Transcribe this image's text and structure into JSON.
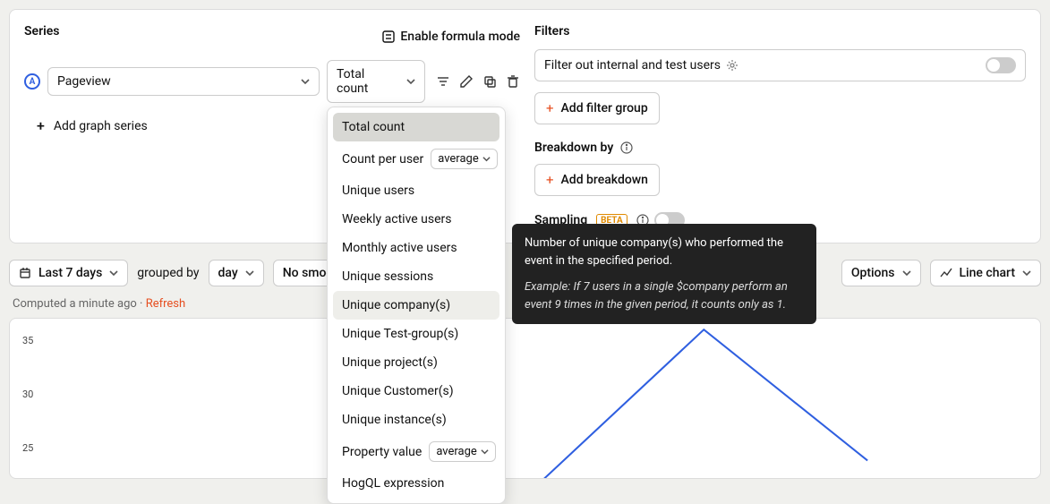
{
  "series": {
    "label": "Series",
    "formula_mode": "Enable formula mode",
    "badge": "A",
    "event": "Pageview",
    "agg": "Total count",
    "add_series": "Add graph series"
  },
  "dropdown": {
    "items": [
      {
        "label": "Total count",
        "sub": null,
        "state": "selected"
      },
      {
        "label": "Count per user",
        "sub": "average",
        "state": ""
      },
      {
        "label": "Unique users",
        "sub": null,
        "state": ""
      },
      {
        "label": "Weekly active users",
        "sub": null,
        "state": ""
      },
      {
        "label": "Monthly active users",
        "sub": null,
        "state": ""
      },
      {
        "label": "Unique sessions",
        "sub": null,
        "state": ""
      },
      {
        "label": "Unique company(s)",
        "sub": null,
        "state": "hover"
      },
      {
        "label": "Unique Test-group(s)",
        "sub": null,
        "state": ""
      },
      {
        "label": "Unique project(s)",
        "sub": null,
        "state": ""
      },
      {
        "label": "Unique Customer(s)",
        "sub": null,
        "state": ""
      },
      {
        "label": "Unique instance(s)",
        "sub": null,
        "state": ""
      },
      {
        "label": "Property value",
        "sub": "average",
        "state": ""
      },
      {
        "label": "HogQL expression",
        "sub": null,
        "state": ""
      }
    ]
  },
  "tooltip": {
    "body": "Number of unique company(s) who performed the event in the specified period.",
    "example": "Example: If 7 users in a single $company perform an event 9 times in the given period, it counts only as 1."
  },
  "filters": {
    "label": "Filters",
    "default_filter": "Filter out internal and test users",
    "add_filter_group": "Add filter group",
    "breakdown_label": "Breakdown by",
    "add_breakdown": "Add breakdown",
    "sampling_label": "Sampling",
    "sampling_badge": "BETA"
  },
  "controls": {
    "range": "Last 7 days",
    "grouped_by": "grouped by",
    "unit": "day",
    "smoothing": "No smoothin",
    "options": "Options",
    "chart_type": "Line chart"
  },
  "status": {
    "computed": "Computed a minute ago",
    "sep": "·",
    "refresh": "Refresh"
  },
  "chart_data": {
    "type": "line",
    "y_ticks": [
      35,
      30,
      25
    ],
    "ylim": [
      22,
      37
    ],
    "series": [
      {
        "name": "Pageview",
        "color": "#2f5fe0",
        "values": [
          null,
          null,
          null,
          22,
          36,
          24,
          null
        ]
      }
    ]
  }
}
